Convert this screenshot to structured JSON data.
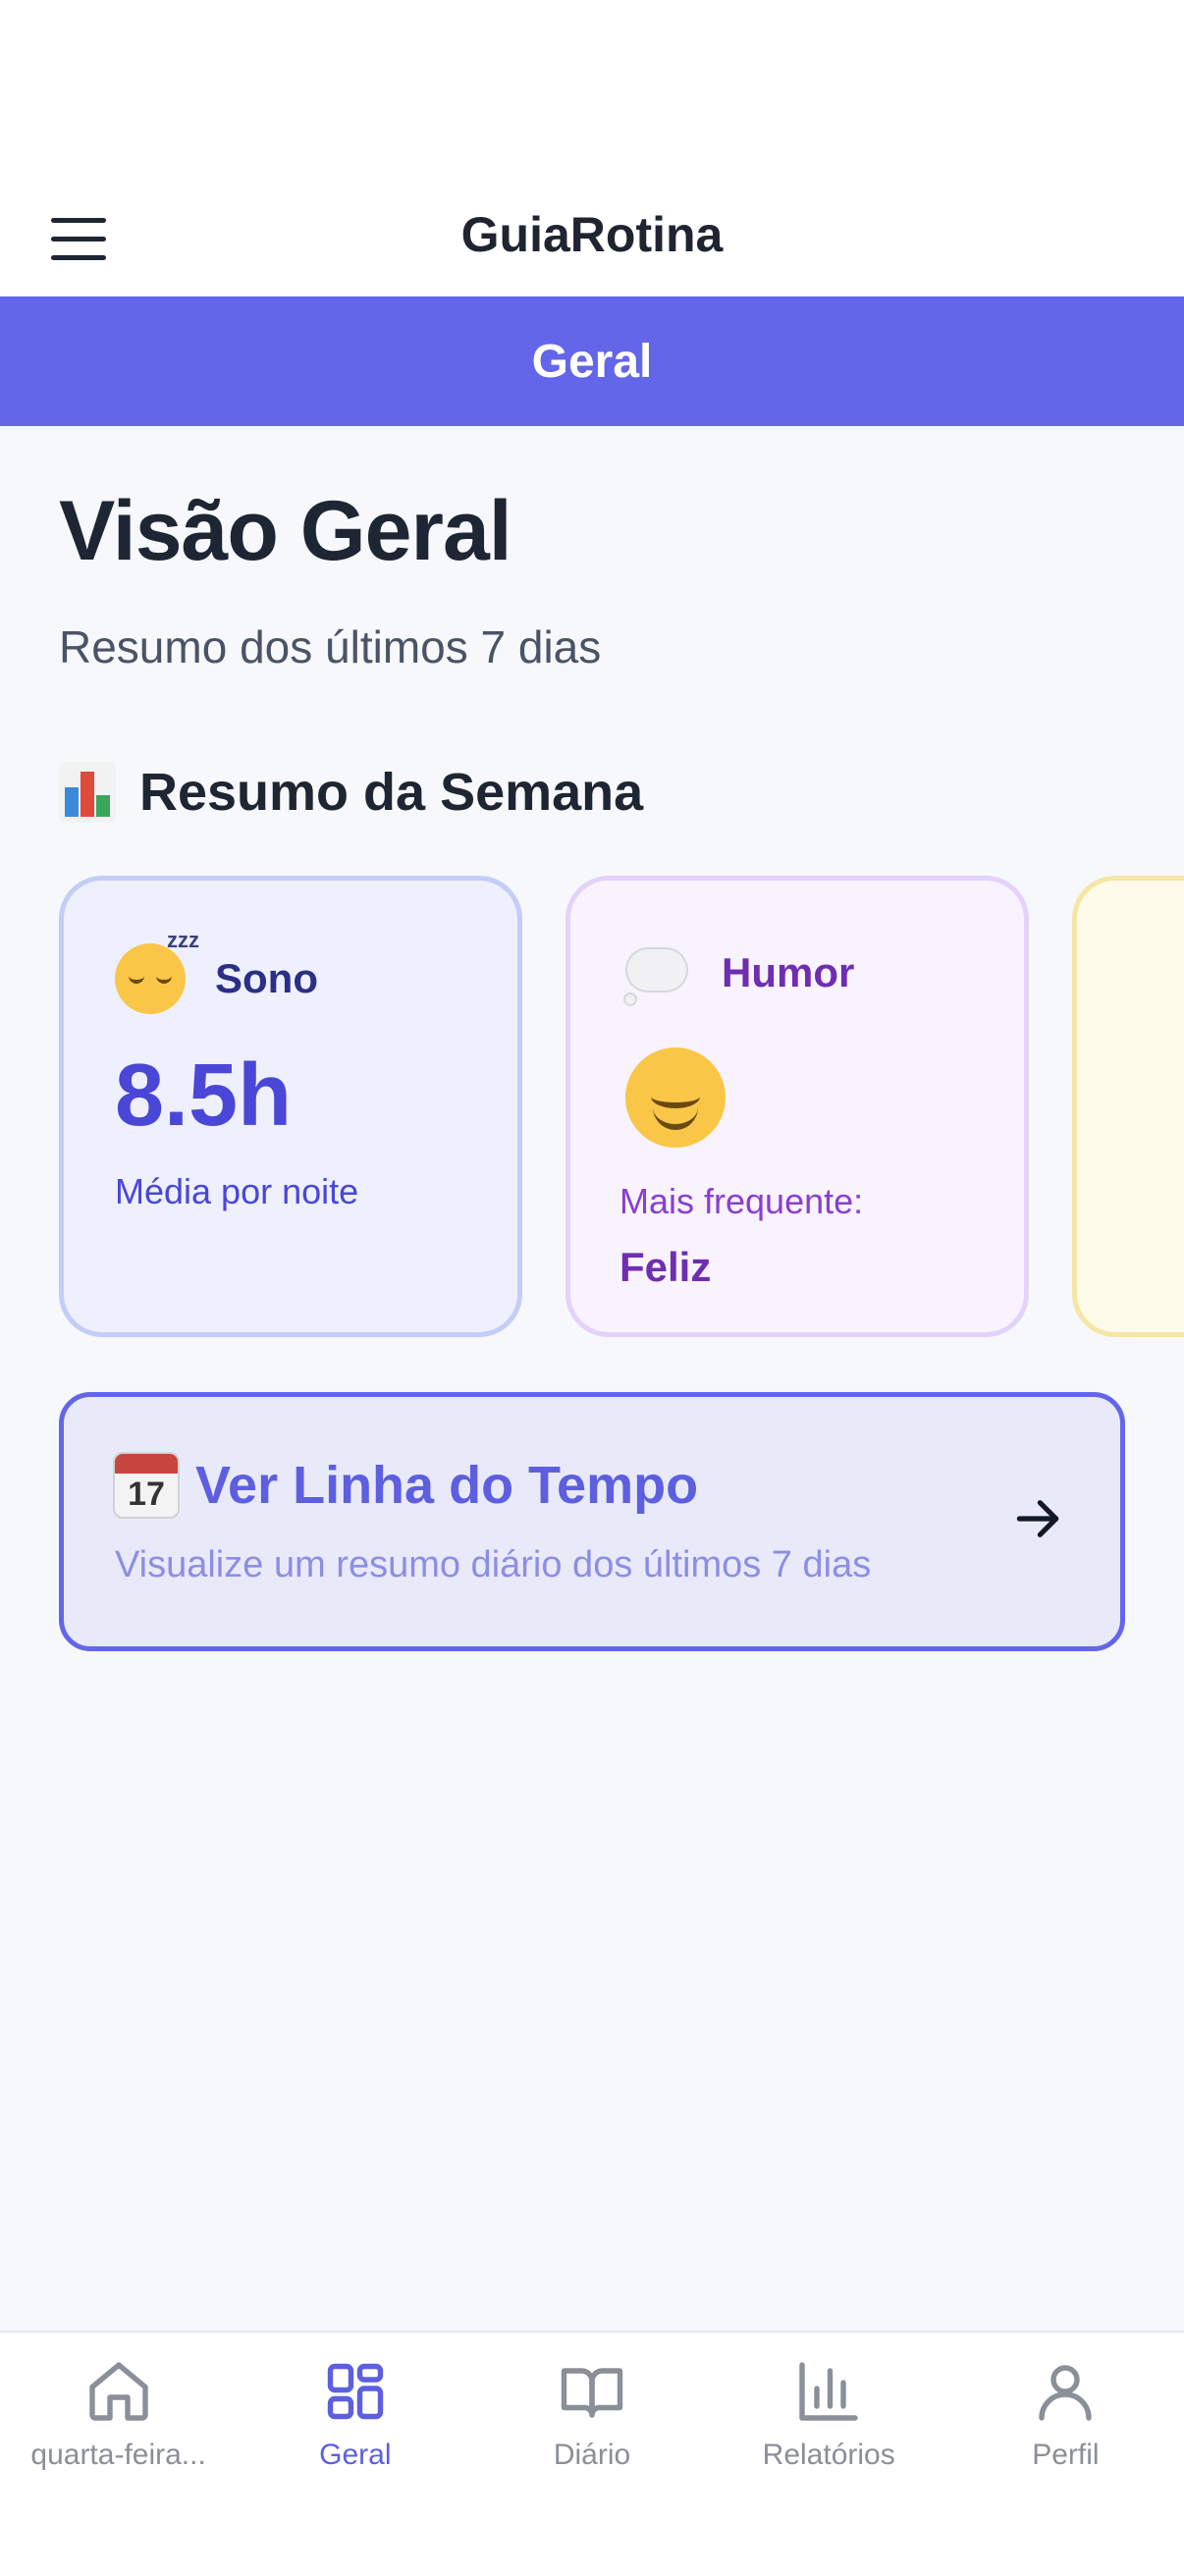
{
  "app": {
    "title": "GuiaRotina",
    "menu_icon": "hamburger-menu-icon"
  },
  "section_bar": {
    "label": "Geral",
    "color": "#6366e9"
  },
  "main": {
    "title": "Visão Geral",
    "subtitle": "Resumo dos últimos 7 dias",
    "week_summary": {
      "heading": "Resumo da Semana",
      "icon": "bar-chart-emoji-icon"
    },
    "cards": {
      "sleep": {
        "title": "Sono",
        "icon": "sleeping-face-emoji-icon",
        "zzz": "zzz",
        "value": "8.5h",
        "label": "Média por noite"
      },
      "mood": {
        "title": "Humor",
        "icon": "thought-balloon-emoji-icon",
        "face_icon": "smiling-face-emoji-icon",
        "label": "Mais frequente:",
        "value": "Feliz"
      }
    },
    "timeline": {
      "title": "Ver Linha do Tempo",
      "description": "Visualize um resumo diário dos últimos 7 dias",
      "icon": "calendar-emoji-icon",
      "calendar_day": "17",
      "arrow_icon": "arrow-right-icon"
    }
  },
  "bottom_nav": {
    "items": [
      {
        "label": "quarta-feira...",
        "icon": "home-icon",
        "active": false
      },
      {
        "label": "Geral",
        "icon": "grid-icon",
        "active": true
      },
      {
        "label": "Diário",
        "icon": "book-open-icon",
        "active": false
      },
      {
        "label": "Relatórios",
        "icon": "bar-chart-icon",
        "active": false
      },
      {
        "label": "Perfil",
        "icon": "user-icon",
        "active": false
      }
    ],
    "active_color": "#5d5fe0",
    "inactive_color": "#8a8f98"
  }
}
